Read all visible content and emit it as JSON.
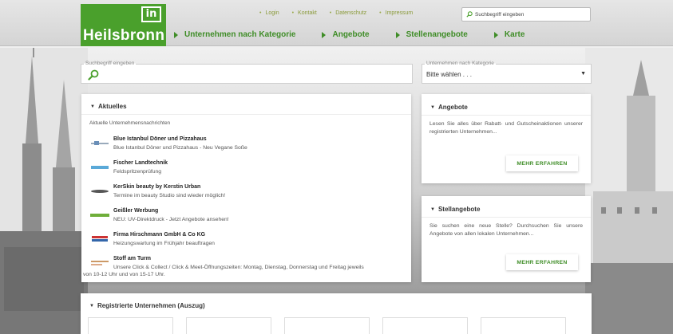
{
  "brand": {
    "logo_mark": "in",
    "name": "Heilsbronn",
    "color": "#4aa02c"
  },
  "topnav": [
    "Login",
    "Kontakt",
    "Datenschutz",
    "Impressum"
  ],
  "header_search": {
    "placeholder": "Suchbegriff eingeben",
    "icon": "search-icon"
  },
  "mainnav": [
    "Unternehmen nach Kategorie",
    "Angebote",
    "Stellenangebote",
    "Karte"
  ],
  "search": {
    "label": "Suchbegriff eingeben",
    "icon": "search-icon"
  },
  "category": {
    "label": "Unternehmen nach Kategorie",
    "value": "Bitte wählen . . ."
  },
  "aktuelles": {
    "title": "Aktuelles",
    "subtitle": "Aktuelle Unternehmensnachrichten",
    "items": [
      {
        "title": "Blue Istanbul Döner und Pizzahaus",
        "desc": "Blue Istanbul Döner und Pizzahaus - Neu Vegane Soße"
      },
      {
        "title": "Fischer Landtechnik",
        "desc": "Feldspritzenprüfung"
      },
      {
        "title": "KerSkin beauty by Kerstin Urban",
        "desc": "Termine im beauty Studio sind wieder möglich!"
      },
      {
        "title": "Geißler Werbung",
        "desc": "NEU: UV-Direktdruck - Jetzt Angebote ansehen!"
      },
      {
        "title": "Firma Hirschmann GmbH & Co KG",
        "desc": "Heizungswartung im Frühjahr beauftragen"
      },
      {
        "title": "Stoff am Turm",
        "desc": "Unsere Click & Collect / Click & Meet-Öffnungszeiten: Montag, Dienstag, Donnerstag und Freitag jeweils",
        "desc2": "von 10-12 Uhr und von 15-17 Uhr."
      }
    ]
  },
  "angebote": {
    "title": "Angebote",
    "text": "Lesen Sie alles über Rabatt- und Gutscheinaktionen unserer registrierten Unternehmen...",
    "button": "MEHR ERFAHREN"
  },
  "stellen": {
    "title": "Stellangebote",
    "text": "Sie suchen eine neue Stelle? Durchsuchen Sie unsere Angebote von allen lokalen Unternehmen...",
    "button": "MEHR ERFAHREN"
  },
  "registered": {
    "title": "Registrierte Unternehmen (Auszug)"
  }
}
